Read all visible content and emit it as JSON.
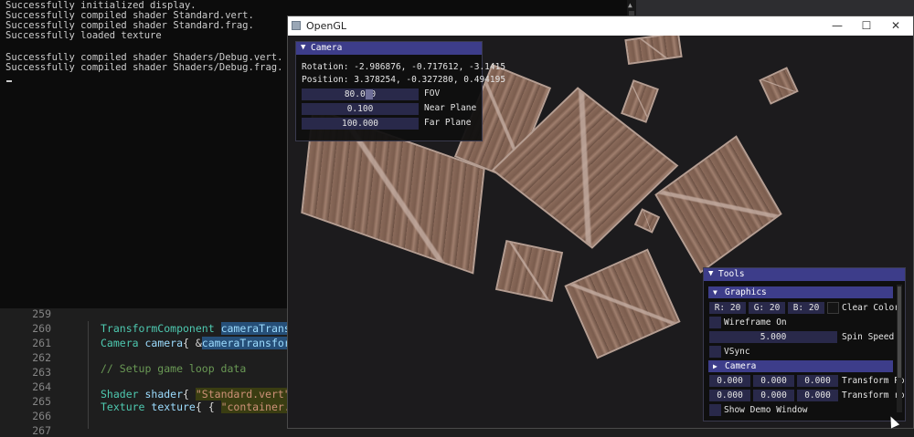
{
  "console": {
    "lines": [
      "Successfully initialized display.",
      "Successfully compiled shader Standard.vert.",
      "Successfully compiled shader Standard.frag.",
      "Successfully loaded texture",
      "",
      "Successfully compiled shader Shaders/Debug.vert.",
      "Successfully compiled shader Shaders/Debug.frag."
    ]
  },
  "editor": {
    "line_numbers": [
      "259",
      "260",
      "261",
      "262",
      "263",
      "264",
      "265",
      "266",
      "267"
    ],
    "code": {
      "l260_type": "TransformComponent ",
      "l260_var": "cameraTransfo",
      "l261_type": "Camera ",
      "l261_var": "camera",
      "l261_rest": "{ &",
      "l261_var2": "cameraTransform",
      "l261_end": ",",
      "l263_comment": "// Setup game loop data",
      "l265_type": "Shader ",
      "l265_var": "shader",
      "l265_rest": "{ ",
      "l265_str": "\"Standard.vert\"",
      "l265_end": ",",
      "l266_type": "Texture ",
      "l266_var": "texture",
      "l266_rest": "{ { ",
      "l266_str": "\"container.jp"
    }
  },
  "gl_window": {
    "title": "OpenGL",
    "buttons": {
      "minimize": "—",
      "maximize": "☐",
      "close": "✕"
    }
  },
  "camera_panel": {
    "title": "Camera",
    "rotation": "Rotation: -2.986876, -0.717612, -3.1415",
    "position": "Position: 3.378254, -0.327280, 0.494195",
    "fov_value": "80.000",
    "fov_label": "FOV",
    "fov_fraction": 0.58,
    "near_value": "0.100",
    "near_label": "Near Plane",
    "far_value": "100.000",
    "far_label": "Far Plane"
  },
  "tools_panel": {
    "title": "Tools",
    "graphics_header": "Graphics",
    "r": "R: 20",
    "g": "G: 20",
    "b": "B: 20",
    "clear_color_label": "Clear Color",
    "wireframe_label": "Wireframe On",
    "spin_value": "5.000",
    "spin_label": "Spin Speed",
    "vsync_label": "VSync",
    "camera_header": "Camera",
    "tp": [
      "0.000",
      "0.000",
      "0.000"
    ],
    "tp_label": "Transform Po",
    "tr": [
      "0.000",
      "0.000",
      "0.000"
    ],
    "tr_label": "Transform ro",
    "demo_label": "Show Demo Window"
  },
  "colors": {
    "imgui_header": "#3d3d8a",
    "imgui_frame": "#29294a",
    "crate_edge": "#b69e92"
  }
}
